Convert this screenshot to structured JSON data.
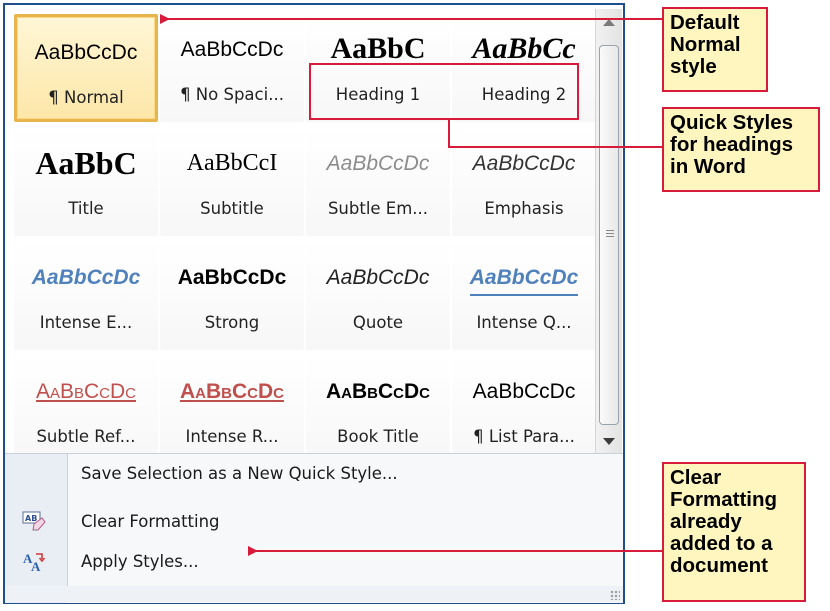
{
  "gallery": {
    "styles": [
      {
        "preview": "AaBbCcDc",
        "name": "¶ Normal",
        "cls": "pv-normal",
        "selected": true
      },
      {
        "preview": "AaBbCcDc",
        "name": "¶ No Spaci...",
        "cls": "pv-nospacing"
      },
      {
        "preview": "AaBbC",
        "name": "Heading 1",
        "cls": "pv-h1"
      },
      {
        "preview": "AaBbCc",
        "name": "Heading 2",
        "cls": "pv-h2"
      },
      {
        "preview": "AaBbC",
        "name": "Title",
        "cls": "pv-title"
      },
      {
        "preview": "AaBbCcI",
        "name": "Subtitle",
        "cls": "pv-subtitle"
      },
      {
        "preview": "AaBbCcDc",
        "name": "Subtle Em...",
        "cls": "pv-subtleem"
      },
      {
        "preview": "AaBbCcDc",
        "name": "Emphasis",
        "cls": "pv-emphasis"
      },
      {
        "preview": "AaBbCcDc",
        "name": "Intense E...",
        "cls": "pv-intenseem"
      },
      {
        "preview": "AaBbCcDc",
        "name": "Strong",
        "cls": "pv-strong"
      },
      {
        "preview": "AaBbCcDc",
        "name": "Quote",
        "cls": "pv-quote"
      },
      {
        "preview": "AaBbCcDc",
        "name": "Intense Q...",
        "cls": "pv-intenseq"
      },
      {
        "preview": "AaBbCcDc",
        "name": "Subtle Ref...",
        "cls": "pv-subtleref"
      },
      {
        "preview": "AaBbCcDc",
        "name": "Intense R...",
        "cls": "pv-intenseref"
      },
      {
        "preview": "AaBbCcDc",
        "name": "Book Title",
        "cls": "pv-booktitle"
      },
      {
        "preview": "AaBbCcDc",
        "name": "¶ List Para...",
        "cls": "pv-listpara"
      }
    ]
  },
  "menu": {
    "save_selection": "Save Selection as a New Quick Style...",
    "clear_formatting": "Clear Formatting",
    "apply_styles": "Apply Styles...",
    "clear_icon_text": "AB"
  },
  "callouts": {
    "default_normal": [
      "Default",
      "Normal",
      "style"
    ],
    "quick_styles": [
      "Quick Styles",
      "for headings",
      "in Word"
    ],
    "clear_formatting": [
      "Clear",
      "Formatting",
      "already",
      "added to a",
      "document"
    ]
  },
  "colors": {
    "accent_border": "#1f4e8c",
    "callout_border": "#d81b3a",
    "callout_fill": "#fff6bf",
    "selected_tile": "#e8b54c"
  }
}
